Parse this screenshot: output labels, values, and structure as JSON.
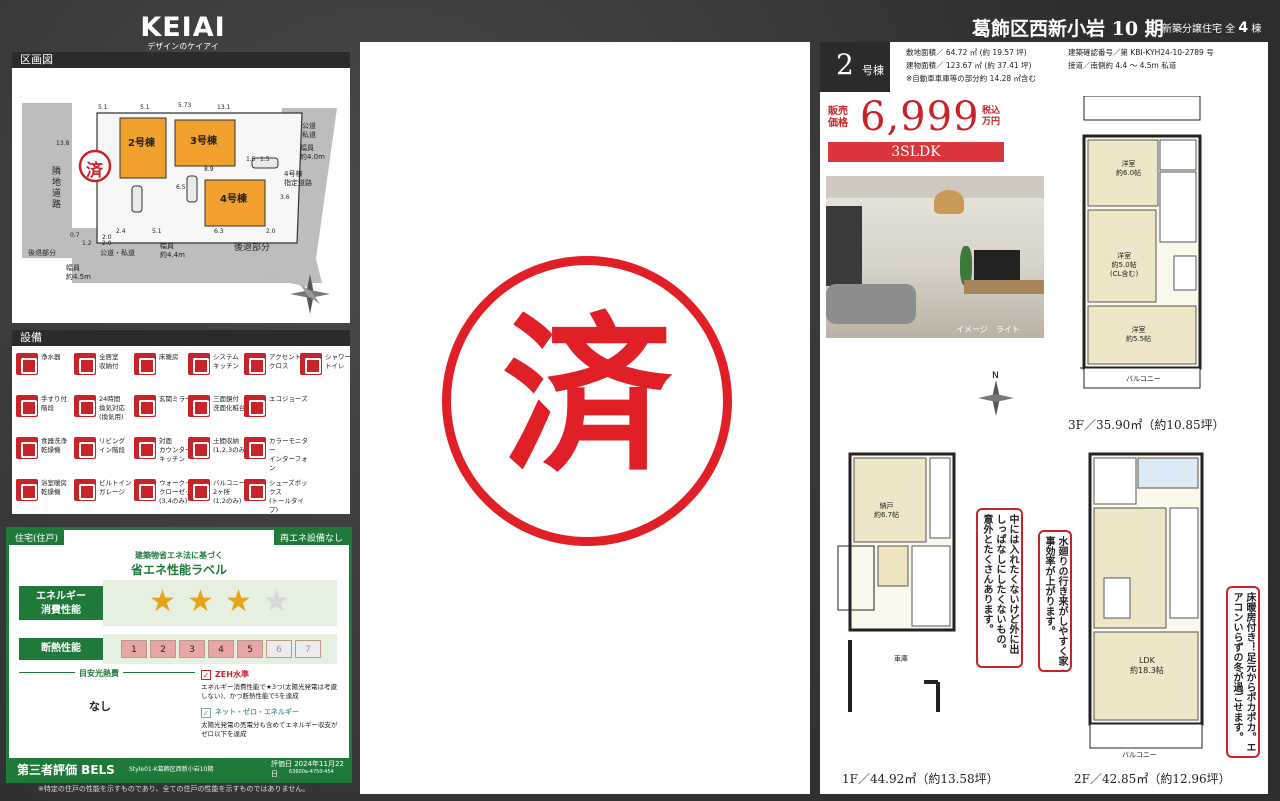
{
  "header": {
    "brand": "KEIAI",
    "tagline": "デザインのケイアイ",
    "title": "葛飾区西新小岩 10 期",
    "sub_prefix": "新築分譲住宅 全",
    "sub_count": "4",
    "sub_suffix": "棟"
  },
  "plot": {
    "heading": "区画図",
    "units": [
      "2号棟",
      "3号棟",
      "4号棟"
    ],
    "sold_mark": "済",
    "labels": {
      "adjacent_road": "隣地道路",
      "public_road": "公道\n私道",
      "width_4m": "幅員\n約4.0m",
      "designated_road": "4号棟\n指定道路",
      "setback_right": "後退部分",
      "setback_left": "後退部分",
      "bottom_road": "公道・私道",
      "width_44": "幅員\n約4.4m",
      "width_45": "幅員\n約4.5m"
    },
    "dims": [
      "5.1",
      "5.1",
      "5.73",
      "13.1",
      "13.8",
      "8.9",
      "6.5",
      "6.3",
      "5.1",
      "2.4",
      "2.0",
      "0.7",
      "1.2",
      "2.0",
      "2.0",
      "3.6",
      "1.5",
      "1.5"
    ]
  },
  "equipment": {
    "heading": "設備",
    "items": [
      "浄水器",
      "全居室\n収納付",
      "床暖房",
      "システム\nキッチン",
      "アクセント\nクロス",
      "シャワー\nトイレ",
      "手すり付\n階段",
      "24時間\n換気対応\n(換気用)",
      "玄関ミラー",
      "三面鏡付\n洗面化粧台",
      "エコジョーズ",
      "食器洗浄\n乾燥機",
      "リビング\nイン階段",
      "対面\nカウンター\nキッチン",
      "土間収納\n(1,2,3のみ)",
      "カラーモニター\nインターフォン",
      "浴室暖房\n乾燥機",
      "ビルトイン\nガレージ",
      "ウォークイン\nクローゼット\n(3,4のみ)",
      "バルコニー\n2ヶ所\n(1,2のみ)",
      "シューズボックス\n(トールタイプ)"
    ]
  },
  "energy": {
    "tag_left": "住宅(住戸)",
    "tag_right": "再エネ設備なし",
    "subtitle": "建築物省エネ法に基づく",
    "title": "省エネ性能ラベル",
    "energy_label": "エネルギー\n消費性能",
    "stars_filled": 3,
    "stars_total": 4,
    "insulation_label": "断熱性能",
    "insulation_levels": [
      "1",
      "2",
      "3",
      "4",
      "5",
      "6",
      "7"
    ],
    "insulation_level": 5,
    "cost_label": "目安光熱費",
    "cost_value": "なし",
    "zeh_title": "ZEH水準",
    "zeh_text": "エネルギー消費性能で★3つ(太陽光発電は考慮しない)、かつ断熱性能で5を達成",
    "net_zero_title": "ネット・ゼロ・エネルギー",
    "net_zero_text": "太陽光発電の売電分も含めてエネルギー収支がゼロ以下を達成",
    "bels_label": "第三者評価 BELS",
    "bels_small": "Style01-K葛飾区西新小岩10期",
    "eval_date": "評価日 2024年11月22日",
    "eval_code": "63600a-4750-454"
  },
  "center": {
    "mark": "済"
  },
  "unit": {
    "number": "2",
    "suffix": "号棟",
    "land_area": "敷地面積／ 64.72 ㎡ (約 19.57 坪)",
    "building_area": "建物面積／ 123.67 ㎡ (約 37.41 坪)",
    "garage_note": "※自動車車庫等の部分約 14.28 ㎡含む",
    "permit": "建築確認番号／第 KBI-KYH24-10-2789 号",
    "road": "接道／南側約 4.4 ～ 4.5m 私道",
    "price_label": "販売\n価格",
    "price": "6,999",
    "price_unit": "税込\n万円",
    "layout": "3SLDK",
    "photo_caption": "イメージ　ライト",
    "floor_3f": "3F／35.90㎡（約10.85坪）",
    "floor_1f": "1F／44.92㎡（約13.58坪）",
    "floor_2f": "2F／42.85㎡（約12.96坪）",
    "rooms_3f": [
      "洋室\n約6.0帖",
      "洋室\n約5.0帖\n(CL含む)",
      "洋室\n約5.5帖",
      "バルコニー"
    ],
    "rooms_1f": [
      "納戸\n約6.7帖",
      "車庫"
    ],
    "rooms_2f": [
      "LDK\n約18.3帖",
      "バルコニー"
    ],
    "callout_1": "中には入れたくないけど外に出しっぱなしにしたくないもの。意外とたくさんあります。",
    "callout_2": "水廻りの行き来がしやすく家事効率が上がります。",
    "callout_3": "床暖房付き！足元からポカポカ。エアコンいらずの冬が過ごせます。"
  },
  "footnote": "※特定の住戸の性能を示すものであり、全ての住戸の性能を示すものではありません。",
  "colors": {
    "accent_red": "#c9232a",
    "green": "#1f7a3a",
    "orange": "#f2a12e",
    "dark": "#2b2b2b"
  }
}
